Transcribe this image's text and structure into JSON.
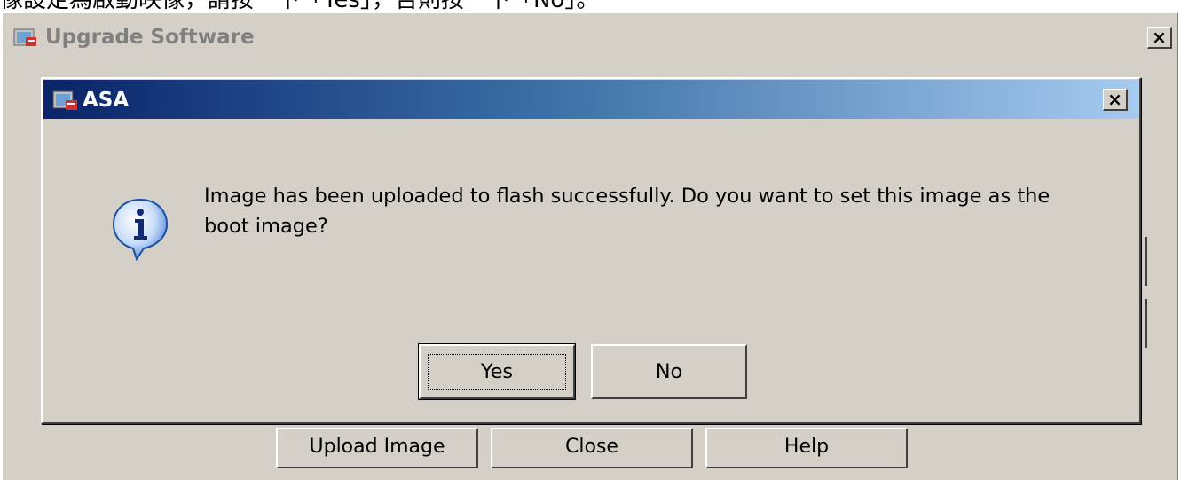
{
  "caption": "像設定為啟動映像，請按一下「Yes」，否則按一下「No」。",
  "parent_window": {
    "title": "Upgrade Software",
    "close_label": "×",
    "buttons": {
      "upload": "Upload Image",
      "close": "Close",
      "help": "Help"
    }
  },
  "dialog": {
    "title": "ASA",
    "close_label": "×",
    "icon": "info-icon",
    "message": "Image has been uploaded to flash successfully. Do you want to set this image as the boot image?",
    "yes_label": "Yes",
    "no_label": "No"
  },
  "colors": {
    "window_bg": "#d4d0c8",
    "title_gradient_start": "#0a246a",
    "title_gradient_end": "#a6caf0",
    "info_icon_blue": "#2a6fd6"
  }
}
